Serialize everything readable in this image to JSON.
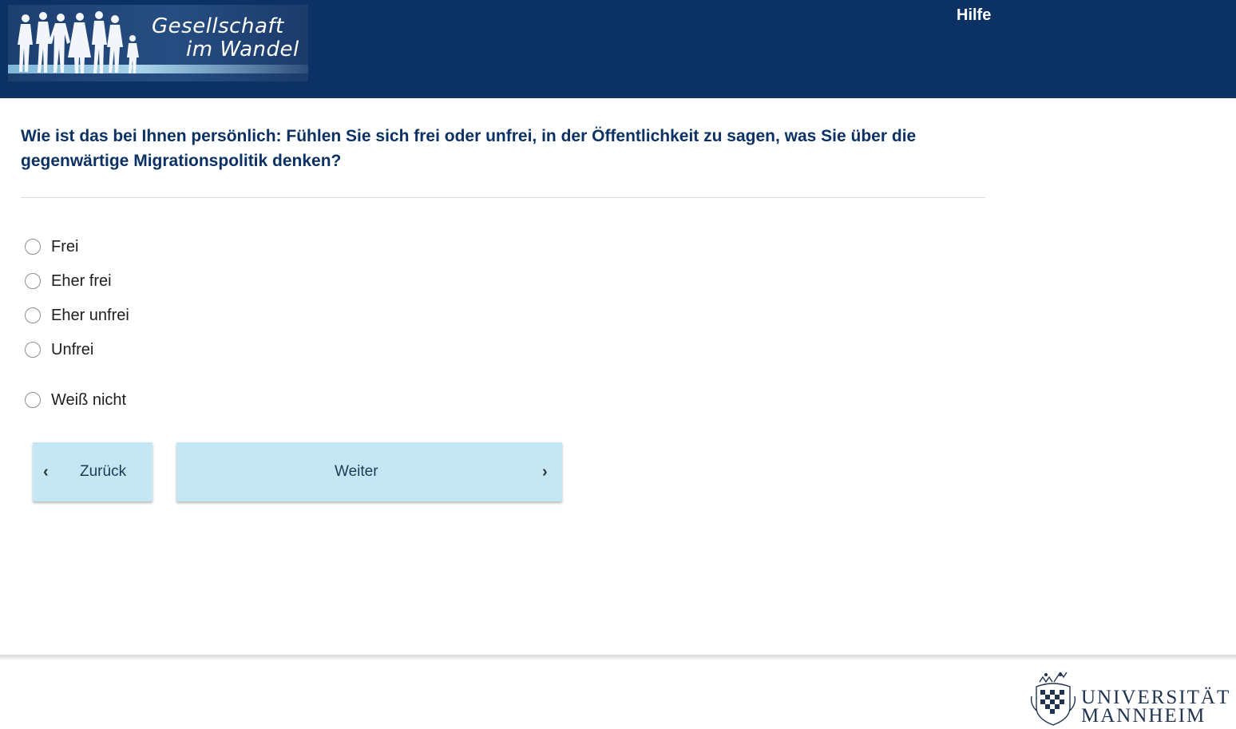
{
  "header": {
    "logo": {
      "line1": "Gesellschaft",
      "line2": "im Wandel"
    },
    "help_label": "Hilfe"
  },
  "question": {
    "text": "Wie ist das bei Ihnen persönlich: Fühlen Sie sich frei oder unfrei, in der Öffentlichkeit zu sagen, was Sie über die gegenwärtige Migrationspolitik denken?"
  },
  "options": [
    {
      "label": "Frei",
      "selected": false
    },
    {
      "label": "Eher frei",
      "selected": false
    },
    {
      "label": "Eher unfrei",
      "selected": false
    },
    {
      "label": "Unfrei",
      "selected": false
    },
    {
      "label": "Weiß nicht",
      "selected": false
    }
  ],
  "navigation": {
    "back_label": "Zurück",
    "back_icon": "chevron-left-icon",
    "next_label": "Weiter",
    "next_icon": "chevron-right-icon"
  },
  "footer": {
    "university_line1": "UNIVERSITÄT",
    "university_line2": "MANNHEIM"
  },
  "colors": {
    "header_bg": "#0b3165",
    "question_text": "#0b3165",
    "button_bg": "#c5e7f4",
    "university_text": "#1f3450"
  }
}
